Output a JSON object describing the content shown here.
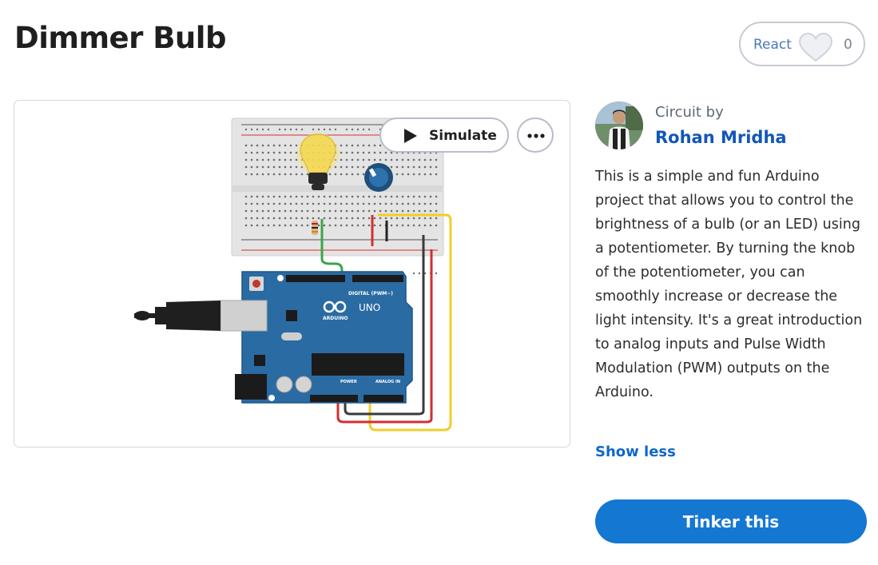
{
  "project": {
    "title": "Dimmer Bulb"
  },
  "reactions": {
    "label": "React",
    "count": "0",
    "icon": "heart-icon"
  },
  "viewer": {
    "simulate_label": "Simulate",
    "simulate_icon": "play-icon",
    "more_icon": "more-options-icon",
    "board_labels": {
      "uno": "UNO",
      "brand": "ARDUINO",
      "digital": "DIGITAL (PWM~)",
      "power": "POWER",
      "analog": "ANALOG IN"
    }
  },
  "author": {
    "prefix": "Circuit by",
    "name": "Rohan Mridha"
  },
  "description": "This is a simple and fun Arduino project that allows you to control the brightness of a bulb (or an LED) using a potentiometer. By turning the knob of the potentiometer, you can smoothly increase or decrease the light intensity. It's a great introduction to analog inputs and Pulse Width Modulation (PWM) outputs on the Arduino.",
  "actions": {
    "show_less": "Show less",
    "tinker": "Tinker this"
  },
  "colors": {
    "accent": "#1477d2",
    "link": "#1257b7",
    "board": "#2a6ba3",
    "wire_green": "#3aa64a",
    "wire_yellow": "#f2cd2a",
    "wire_red": "#d32f2f"
  }
}
